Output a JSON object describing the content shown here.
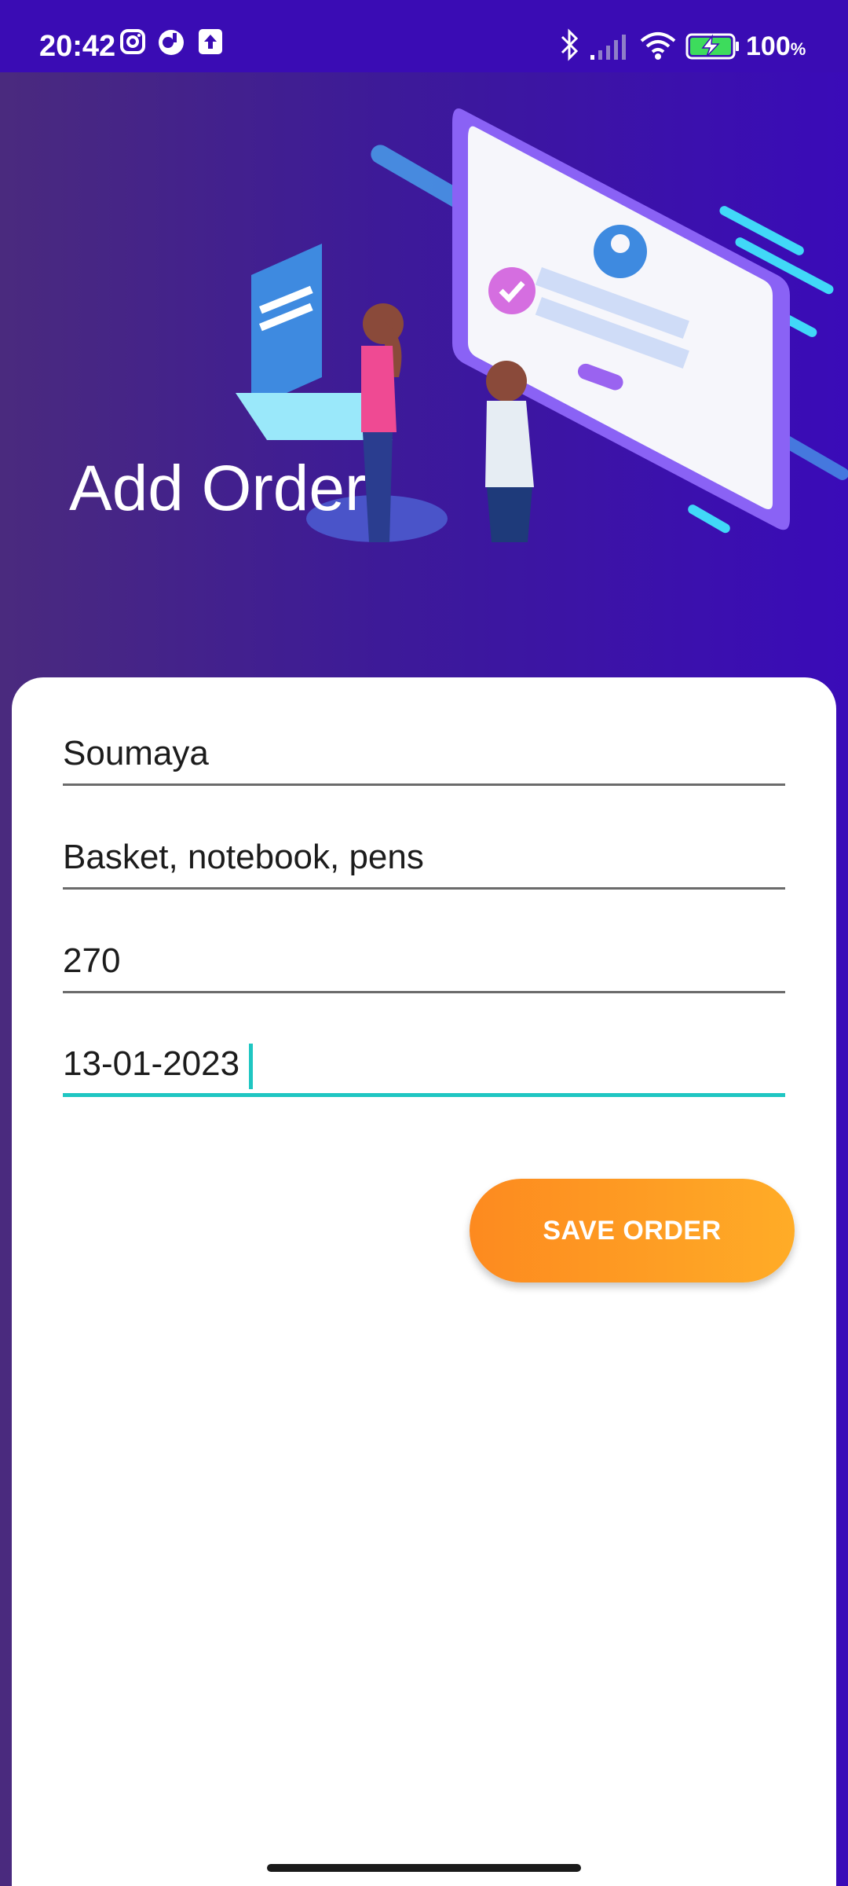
{
  "status_bar": {
    "time": "20:42",
    "battery_level": "100",
    "battery_unit": "%",
    "icons": [
      "instagram-icon",
      "app-icon",
      "upload-icon",
      "bluetooth-icon",
      "signal-icon",
      "wifi-icon",
      "battery-charging-icon"
    ]
  },
  "header": {
    "title": "Add Order"
  },
  "form": {
    "customer_name": "Soumaya",
    "items": "Basket, notebook, pens",
    "price": "270",
    "date": "13-01-2023",
    "save_label": "SAVE ORDER"
  },
  "colors": {
    "header_gradient_start": "#4a2a7e",
    "header_gradient_end": "#3a0bb8",
    "accent": "#1fc6c2",
    "button_start": "#fd8a1f",
    "button_end": "#ffac27"
  }
}
